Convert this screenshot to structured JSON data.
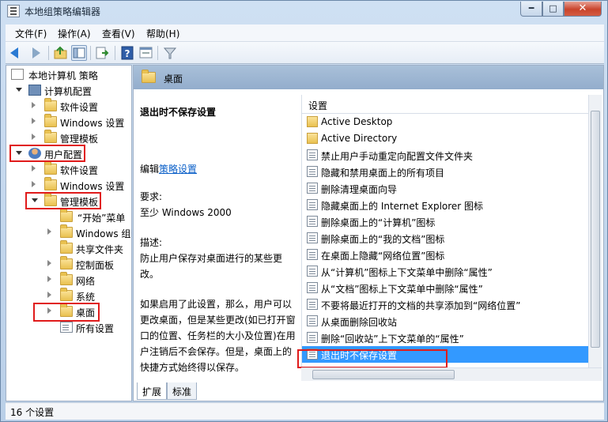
{
  "window": {
    "title": "本地组策略编辑器"
  },
  "menu": [
    "文件(F)",
    "操作(A)",
    "查看(V)",
    "帮助(H)"
  ],
  "tree": {
    "root": "本地计算机 策略",
    "computer": "计算机配置",
    "computer_children": [
      "软件设置",
      "Windows 设置",
      "管理模板"
    ],
    "user": "用户配置",
    "user_children": [
      "软件设置",
      "Windows 设置",
      "管理模板"
    ],
    "templates_children": [
      "“开始”菜单",
      "Windows 组件",
      "共享文件夹",
      "控制面板",
      "网络",
      "系统",
      "桌面",
      "所有设置"
    ]
  },
  "panel": {
    "header": "桌面",
    "selected_title": "退出时不保存设置",
    "edit_prefix": "编辑",
    "edit_link": "策略设置",
    "requirement_label": "要求:",
    "requirement_value": "至少 Windows 2000",
    "description_label": "描述:",
    "description_1": "防止用户保存对桌面进行的某些更改。",
    "description_2": "如果启用了此设置，那么，用户可以更改桌面，但是某些更改(如已打开窗口的位置、任务栏的大小及位置)在用户注销后不会保存。但是，桌面上的快捷方式始终得以保存。"
  },
  "settings": {
    "column_header": "设置",
    "items": [
      {
        "label": "Active Desktop",
        "type": "folder"
      },
      {
        "label": "Active Directory",
        "type": "folder"
      },
      {
        "label": "禁止用户手动重定向配置文件文件夹",
        "type": "setting"
      },
      {
        "label": "隐藏和禁用桌面上的所有项目",
        "type": "setting"
      },
      {
        "label": "删除清理桌面向导",
        "type": "setting"
      },
      {
        "label": "隐藏桌面上的 Internet Explorer 图标",
        "type": "setting"
      },
      {
        "label": "删除桌面上的“计算机”图标",
        "type": "setting"
      },
      {
        "label": "删除桌面上的“我的文档”图标",
        "type": "setting"
      },
      {
        "label": "在桌面上隐藏“网络位置”图标",
        "type": "setting"
      },
      {
        "label": "从“计算机”图标上下文菜单中删除“属性”",
        "type": "setting"
      },
      {
        "label": "从“文档”图标上下文菜单中删除“属性”",
        "type": "setting"
      },
      {
        "label": "不要将最近打开的文档的共享添加到“网络位置”",
        "type": "setting"
      },
      {
        "label": "从桌面删除回收站",
        "type": "setting"
      },
      {
        "label": "删除“回收站”上下文菜单的“属性”",
        "type": "setting"
      },
      {
        "label": "退出时不保存设置",
        "type": "setting",
        "selected": true
      }
    ]
  },
  "tabs": [
    "扩展",
    "标准"
  ],
  "status": "16 个设置",
  "colors": {
    "selection": "#3399ff",
    "highlight_box": "#e01b1b",
    "link": "#0a5fc8"
  }
}
